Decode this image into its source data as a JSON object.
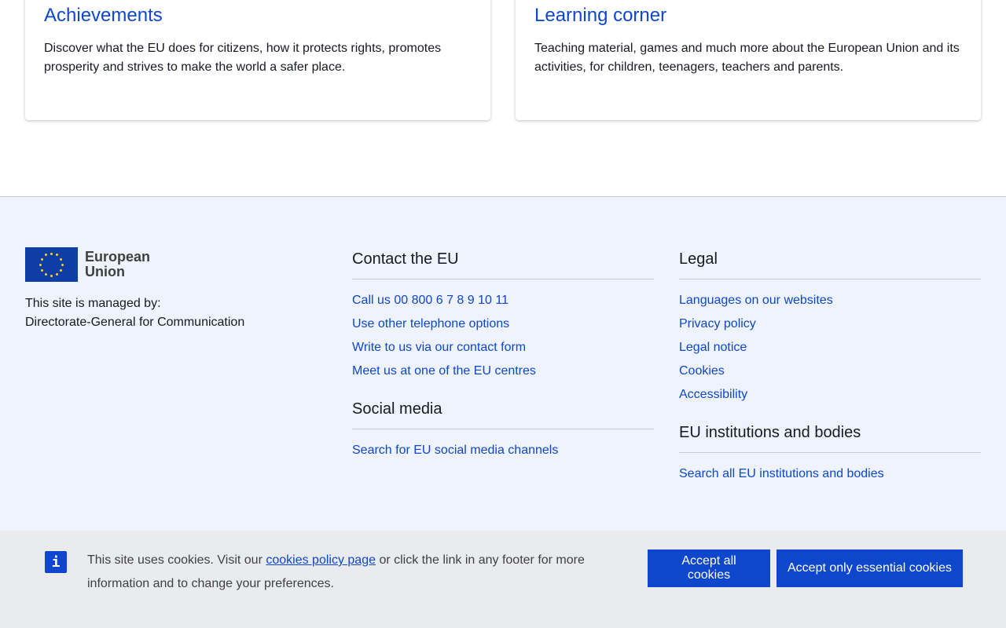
{
  "cards": [
    {
      "title": "Achievements",
      "text": "Discover what the EU does for citizens, how it protects rights, promotes prosperity and strives to make the world a safer place."
    },
    {
      "title": "Learning corner",
      "text": "Teaching material, games and much more about the European Union and its activities, for children, teenagers, teachers and parents."
    }
  ],
  "footer": {
    "logo": {
      "line1": "European",
      "line2": "Union"
    },
    "managed_by_label": "This site is managed by:",
    "managed_by_value": "Directorate-General for Communication",
    "contact": {
      "heading": "Contact the EU",
      "links": [
        "Call us 00 800 6 7 8 9 10 11",
        "Use other telephone options",
        "Write to us via our contact form",
        "Meet us at one of the EU centres"
      ]
    },
    "social": {
      "heading": "Social media",
      "links": [
        "Search for EU social media channels"
      ]
    },
    "legal": {
      "heading": "Legal",
      "links": [
        "Languages on our websites",
        "Privacy policy",
        "Legal notice",
        "Cookies",
        "Accessibility"
      ]
    },
    "institutions": {
      "heading": "EU institutions and bodies",
      "links": [
        "Search all EU institutions and bodies"
      ]
    }
  },
  "cookie_banner": {
    "icon": "info-icon",
    "text_before": "This site uses cookies. Visit our ",
    "link_text": "cookies policy page",
    "text_after": " or click the link in any footer for more information and to change your preferences.",
    "accept_all": "Accept all cookies",
    "accept_essential": "Accept only essential cookies"
  },
  "colors": {
    "link": "#0e47cb",
    "footer_bg": "#eef3fd",
    "banner_bg": "#e9ebef",
    "flag_blue": "#0e3da6",
    "flag_star": "#ffd617"
  }
}
